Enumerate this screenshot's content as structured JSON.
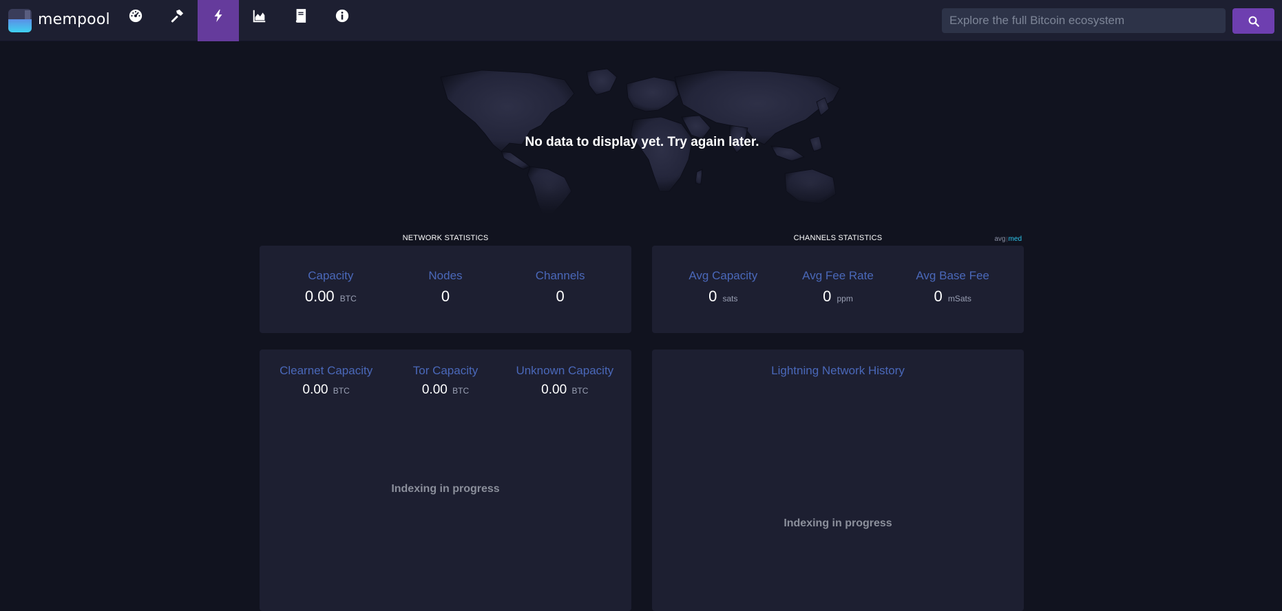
{
  "app": {
    "brand": "mempool"
  },
  "nav": {
    "items": [
      {
        "icon": "dashboard-icon"
      },
      {
        "icon": "hammer-icon"
      },
      {
        "icon": "lightning-icon",
        "active": true
      },
      {
        "icon": "chart-area-icon"
      },
      {
        "icon": "book-icon"
      },
      {
        "icon": "info-icon"
      }
    ],
    "active_color": "#653b9c"
  },
  "search": {
    "placeholder": "Explore the full Bitcoin ecosystem",
    "value": "",
    "button_icon": "search-icon",
    "button_color": "#6e3fb0"
  },
  "map": {
    "message": "No data to display yet. Try again later."
  },
  "network_stats": {
    "title": "NETWORK STATISTICS",
    "items": [
      {
        "label": "Capacity",
        "value": "0.00",
        "unit": "BTC"
      },
      {
        "label": "Nodes",
        "value": "0",
        "unit": ""
      },
      {
        "label": "Channels",
        "value": "0",
        "unit": ""
      }
    ]
  },
  "channel_stats": {
    "title": "CHANNELS STATISTICS",
    "toggle": {
      "avg": "avg",
      "sep": "|",
      "med": "med",
      "selected": "med"
    },
    "items": [
      {
        "label": "Avg Capacity",
        "value": "0",
        "unit": "sats"
      },
      {
        "label": "Avg Fee Rate",
        "value": "0",
        "unit": "ppm"
      },
      {
        "label": "Avg Base Fee",
        "value": "0",
        "unit": "mSats"
      }
    ]
  },
  "capacity_card": {
    "items": [
      {
        "label": "Clearnet Capacity",
        "value": "0.00",
        "unit": "BTC"
      },
      {
        "label": "Tor Capacity",
        "value": "0.00",
        "unit": "BTC"
      },
      {
        "label": "Unknown Capacity",
        "value": "0.00",
        "unit": "BTC"
      }
    ],
    "status": "Indexing in progress"
  },
  "history_card": {
    "title": "Lightning Network History",
    "status": "Indexing in progress"
  },
  "colors": {
    "background": "#11131f",
    "card": "#1d1f31",
    "label": "#4a68b9",
    "muted": "#8b8f9b"
  }
}
